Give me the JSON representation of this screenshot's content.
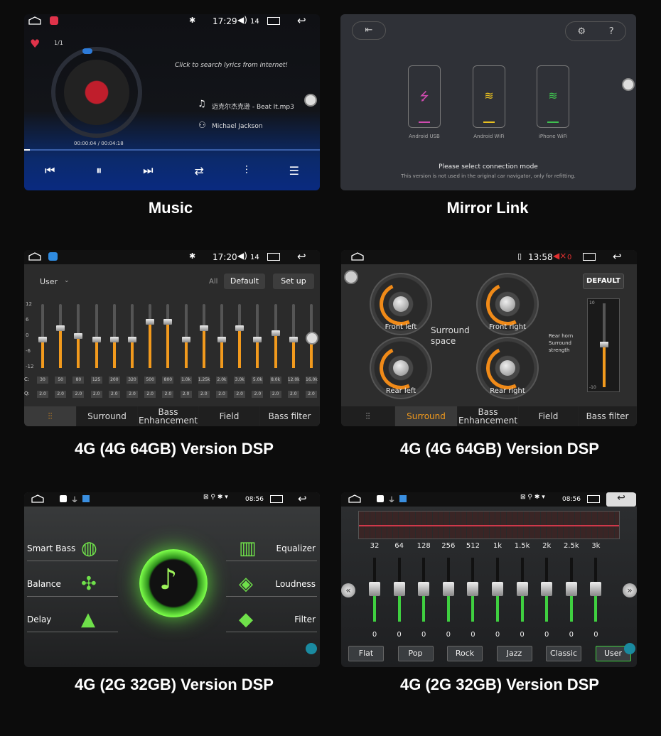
{
  "captions": {
    "music": "Music",
    "mirror": "Mirror Link",
    "eq1": "4G (4G 64GB) Version DSP",
    "eq2": "4G (4G 64GB) Version DSP",
    "dsp": "4G (2G 32GB) Version DSP",
    "eq3": "4G (2G 32GB) Version DSP"
  },
  "music": {
    "time": "17:29",
    "volume": "14",
    "count": "1/1",
    "prompt": "Click to search lyrics from internet!",
    "track": "迈克尔杰克逊 - Beat It.mp3",
    "artist": "Michael Jackson",
    "progress": "00:00:04 / 00:04:18",
    "progress_fraction": 0.02
  },
  "mirror": {
    "options": [
      {
        "label": "Android USB",
        "color": "#d04bb0"
      },
      {
        "label": "Android WiFi",
        "color": "#e8c020"
      },
      {
        "label": "iPhone WiFi",
        "color": "#3fc04f"
      }
    ],
    "title": "Please select connection mode",
    "note": "This version is not used in the original car navigator, only for refitting."
  },
  "eq1": {
    "time": "17:20",
    "volume": "14",
    "preset": "User",
    "all": "All",
    "default_btn": "Default",
    "setup_btn": "Set up",
    "ylabels": [
      "12",
      "6",
      "0",
      "-6",
      "-12"
    ],
    "row_labels": [
      "C:",
      "Q:"
    ],
    "freqs": [
      "30",
      "50",
      "80",
      "125",
      "200",
      "320",
      "500",
      "800",
      "1.0k",
      "1.25k",
      "2.0k",
      "3.0k",
      "5.0k",
      "8.0k",
      "12.0k",
      "16.0k"
    ],
    "q": [
      "2.0",
      "2.0",
      "2.0",
      "2.0",
      "2.0",
      "2.0",
      "2.0",
      "2.0",
      "2.0",
      "2.0",
      "2.0",
      "2.0",
      "2.0",
      "2.0",
      "2.0",
      "2.0"
    ],
    "gains": [
      0.45,
      0.62,
      0.5,
      0.45,
      0.45,
      0.45,
      0.72,
      0.72,
      0.45,
      0.62,
      0.45,
      0.62,
      0.45,
      0.55,
      0.45,
      0.45
    ],
    "tabs": [
      "Surround",
      "Bass Enhancement",
      "Field",
      "Bass filter"
    ]
  },
  "eq2": {
    "time": "13:58",
    "volume": "0",
    "default_btn": "DEFAULT",
    "surround": "Surround space",
    "gauges": [
      "Front left",
      "Front right",
      "Rear left",
      "Rear right"
    ],
    "rear_text": "Rear horn Surround strength",
    "scale_top": "10",
    "scale_bottom": "-10",
    "tabs": [
      "Surround",
      "Bass Enhancement",
      "Field",
      "Bass filter"
    ]
  },
  "dsp": {
    "time": "08:56",
    "left": [
      "Smart Bass",
      "Balance",
      "Delay"
    ],
    "right": [
      "Equalizer",
      "Loudness",
      "Filter"
    ]
  },
  "eq3": {
    "time": "08:56",
    "freqs": [
      "32",
      "64",
      "128",
      "256",
      "512",
      "1k",
      "1.5k",
      "2k",
      "2.5k",
      "3k"
    ],
    "values": [
      "0",
      "0",
      "0",
      "0",
      "0",
      "0",
      "0",
      "0",
      "0",
      "0"
    ],
    "presets": [
      "Flat",
      "Pop",
      "Rock",
      "Jazz",
      "Classic",
      "User"
    ],
    "selected": "User"
  }
}
